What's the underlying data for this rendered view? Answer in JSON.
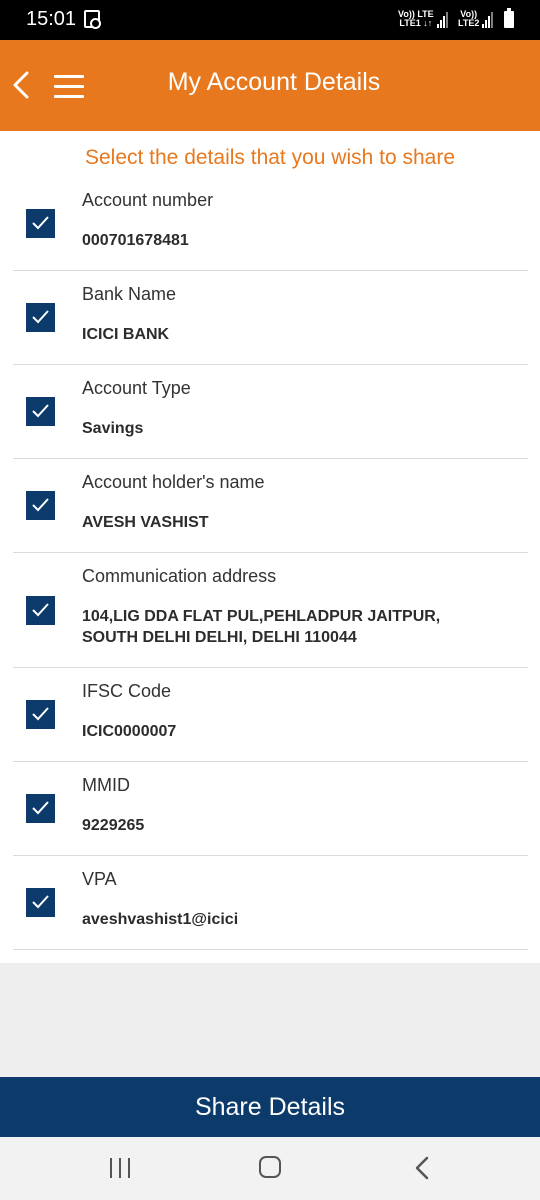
{
  "status_bar": {
    "time": "15:01",
    "sim1_label_top": "Vo)) LTE",
    "sim1_label_bottom": "LTE1 ↓↑",
    "sim2_label_top": "Vo))",
    "sim2_label_bottom": "LTE2"
  },
  "header": {
    "title": "My Account Details",
    "back_icon": "chevron-left-icon",
    "menu_icon": "hamburger-menu-icon",
    "background_color": "#E8781D"
  },
  "instruction": "Select the details that you wish to share",
  "fields": [
    {
      "label": "Account number",
      "value": "000701678481",
      "checked": true
    },
    {
      "label": "Bank Name",
      "value": "ICICI BANK",
      "checked": true
    },
    {
      "label": "Account Type",
      "value": "Savings",
      "checked": true
    },
    {
      "label": "Account holder's name",
      "value": "AVESH VASHIST",
      "checked": true
    },
    {
      "label": "Communication address",
      "value_lines": [
        "104,LIG DDA FLAT PUL,PEHLADPUR JAITPUR,",
        "SOUTH DELHI DELHI, DELHI 110044"
      ],
      "checked": true
    },
    {
      "label": "IFSC Code",
      "value": "ICIC0000007",
      "checked": true
    },
    {
      "label": "MMID",
      "value": "9229265",
      "checked": true
    },
    {
      "label": "VPA",
      "value": "aveshvashist1@icici",
      "checked": true
    }
  ],
  "share_button": {
    "label": "Share Details",
    "color": "#0B3A6B"
  },
  "nav_bar": {
    "recents_icon": "recents-icon",
    "home_icon": "home-icon",
    "back_icon": "back-icon"
  }
}
